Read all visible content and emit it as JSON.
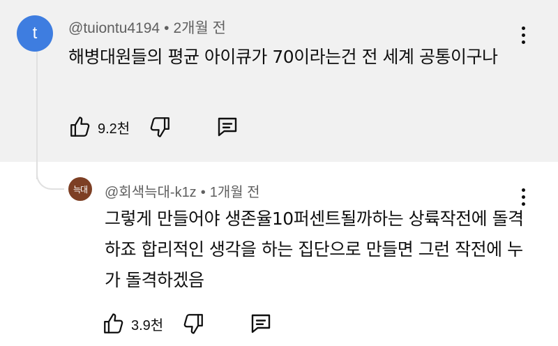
{
  "comment": {
    "avatar_letter": "t",
    "author": "@tuiontu4194",
    "separator": "•",
    "time": "2개월 전",
    "text": "해병대원들의 평균 아이큐가 70이라는건 전 세계 공통이구나",
    "likes": "9.2천",
    "avatar_color": "#3e7de0",
    "background": "#f1f1f1"
  },
  "reply": {
    "avatar_text": "늑대",
    "author": "@회색늑대-k1z",
    "separator": "•",
    "time": "1개월 전",
    "text": "그렇게 만들어야 생존율10퍼센트될까하는 상륙작전에 돌격하죠 합리적인 생각을 하는 집단으로 만들면 그런 작전에 누가 돌격하겠음",
    "likes": "3.9천",
    "avatar_color": "#7d3f24"
  },
  "icons": [
    "thumbs-up-icon",
    "thumbs-down-icon",
    "reply-icon",
    "more-vert-icon"
  ]
}
